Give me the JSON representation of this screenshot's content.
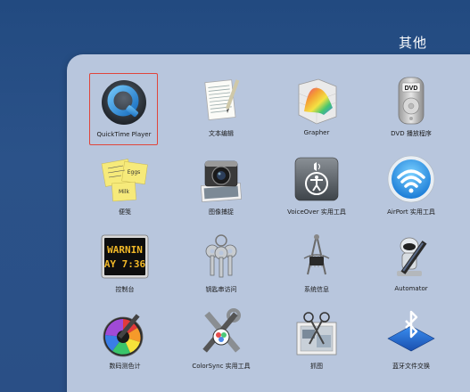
{
  "folder": {
    "title": "其他"
  },
  "apps": [
    {
      "label": "QuickTime Player",
      "icon": "quicktime-icon",
      "selected": true
    },
    {
      "label": "文本编辑",
      "icon": "textedit-icon"
    },
    {
      "label": "Grapher",
      "icon": "grapher-icon"
    },
    {
      "label": "DVD 播放程序",
      "icon": "dvd-player-icon"
    },
    {
      "label": "便笺",
      "icon": "stickies-icon"
    },
    {
      "label": "图像捕捉",
      "icon": "image-capture-icon"
    },
    {
      "label": "VoiceOver 实用工具",
      "icon": "voiceover-icon"
    },
    {
      "label": "AirPort 实用工具",
      "icon": "airport-icon"
    },
    {
      "label": "控制台",
      "icon": "console-icon"
    },
    {
      "label": "钥匙串访问",
      "icon": "keychain-icon"
    },
    {
      "label": "系统信息",
      "icon": "system-info-icon"
    },
    {
      "label": "Automator",
      "icon": "automator-icon"
    },
    {
      "label": "数码测色计",
      "icon": "digital-color-meter-icon"
    },
    {
      "label": "ColorSync 实用工具",
      "icon": "colorsync-icon"
    },
    {
      "label": "抓图",
      "icon": "grab-icon"
    },
    {
      "label": "蓝牙文件交换",
      "icon": "bluetooth-icon"
    }
  ],
  "icon_text": {
    "stickies_note1": "Eggs",
    "stickies_note2": "Milk",
    "console_line1": "WARNIN",
    "console_line2": "AY 7:36",
    "dvd_text": "DVD"
  },
  "colors": {
    "background": "#2a4f85",
    "panel": "#b8c6dd",
    "selection": "#e0453b"
  }
}
